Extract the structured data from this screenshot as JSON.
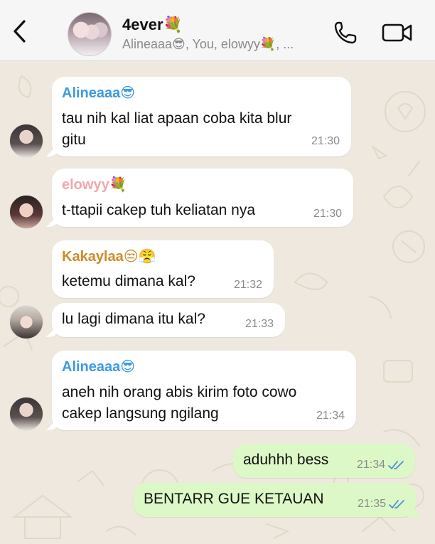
{
  "header": {
    "back_icon": "chevron-left-icon",
    "title": "4ever💐",
    "members": "Alineaaa😎, You, elowyy💐, ...",
    "call_icon": "phone-icon",
    "video_icon": "video-camera-icon"
  },
  "messages": [
    {
      "sender": "Alineaaa😎",
      "sender_color": "#3b9be0",
      "line1": "tau nih kal liat apaan coba kita blur",
      "line2": "gitu",
      "time": "21:30"
    },
    {
      "sender": "elowyy💐",
      "sender_color": "#f1a8a8",
      "line1": "t-ttapii cakep tuh keliatan nya",
      "time": "21:30"
    },
    {
      "sender": "Kakaylaa😒😤",
      "sender_color": "#d08a28",
      "line1": "ketemu dimana kal?",
      "time": "21:32"
    },
    {
      "line1": "lu lagi dimana itu kal?",
      "time": "21:33"
    },
    {
      "sender": "Alineaaa😎",
      "sender_color": "#3b9be0",
      "line1": "aneh nih orang abis kirim foto cowo",
      "line2": "cakep langsung ngilang",
      "time": "21:34"
    },
    {
      "line1": "aduhhh bess",
      "time": "21:34",
      "status": "read"
    },
    {
      "line1": "BENTARR GUE KETAUAN",
      "time": "21:35",
      "status": "read"
    }
  ]
}
